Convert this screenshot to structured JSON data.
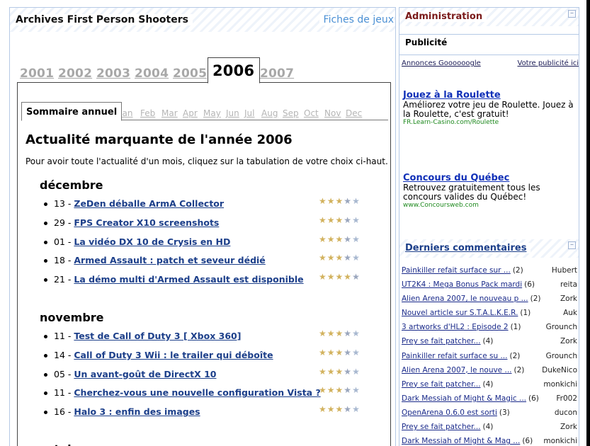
{
  "main": {
    "title": "Archives First Person Shooters",
    "link": "Fiches de jeux",
    "years": [
      {
        "label": "2001",
        "active": false
      },
      {
        "label": "2002",
        "active": false
      },
      {
        "label": "2003",
        "active": false
      },
      {
        "label": "2004",
        "active": false
      },
      {
        "label": "2005",
        "active": false
      },
      {
        "label": "2006",
        "active": true
      },
      {
        "label": "2007",
        "active": false
      }
    ],
    "month_tabs": [
      "Sommaire annuel",
      "Jan",
      "Feb",
      "Mar",
      "Apr",
      "May",
      "Jun",
      "Jul",
      "Aug",
      "Sep",
      "Oct",
      "Nov",
      "Dec"
    ],
    "heading": "Actualité marquante de l'année 2006",
    "intro": "Pour avoir toute l'actualité d'un mois, cliquez sur la tabulation de votre choix ci-haut.",
    "months": [
      {
        "name": "décembre",
        "items": [
          {
            "date": "13",
            "title": "ZeDen déballe ArmA Collector",
            "rating": 3.5
          },
          {
            "date": "29",
            "title": "FPS Creator X10 screenshots",
            "rating": 3.5
          },
          {
            "date": "01",
            "title": "La vidéo DX 10 de Crysis en HD",
            "rating": 3.5
          },
          {
            "date": "18",
            "title": "Armed Assault : patch et seveur dédié",
            "rating": 3.5
          },
          {
            "date": "21",
            "title": "La démo multi d'Armed Assault est disponible",
            "rating": 4.5
          }
        ]
      },
      {
        "name": "novembre",
        "items": [
          {
            "date": "11",
            "title": "Test de Call of Duty 3 [ Xbox 360]",
            "rating": 3.5
          },
          {
            "date": "14",
            "title": "Call of Duty 3 Wii : le trailer qui déboîte",
            "rating": 3.5
          },
          {
            "date": "05",
            "title": "Un avant-goût de DirectX 10",
            "rating": 3.5
          },
          {
            "date": "11",
            "title": "Cherchez-vous une nouvelle configuration Vista ?",
            "rating": 3.5
          },
          {
            "date": "16",
            "title": "Halo 3 : enfin des images",
            "rating": 3.5
          }
        ]
      },
      {
        "name": "octobre",
        "items": []
      }
    ]
  },
  "side": {
    "admin_title": "Administration",
    "collapse_symbol": "–",
    "pub_title": "Publicité",
    "ads_left": "Annonces Goooooogle",
    "ads_right": "Votre publicité ici",
    "ads": [
      {
        "title": "Jouez à la Roulette",
        "text": "Améliorez votre jeu de Roulette. Jouez à la Roulette, c'est gratuit!",
        "url": "FR.Learn-Casino.com/Roulette"
      },
      {
        "title": "Concours du Québec",
        "text": "Retrouvez gratuitement tous les concours valides du Québec!",
        "url": "www.Concoursweb.com"
      }
    ],
    "comments_title": "Derniers commentaires",
    "comments": [
      {
        "title": "Painkiller refait surface sur ...",
        "count": "(2)",
        "author": "Hubert"
      },
      {
        "title": "UT2K4 : Mega Bonus Pack mardi",
        "count": "(6)",
        "author": "reita"
      },
      {
        "title": "Alien Arena 2007, le nouveau p ...",
        "count": "(2)",
        "author": "Zork"
      },
      {
        "title": "Nouvel article sur S.T.A.L.K.E.R.",
        "count": "(1)",
        "author": "Auk"
      },
      {
        "title": "3 artworks d'HL2 : Episode 2",
        "count": "(1)",
        "author": "Grounch"
      },
      {
        "title": "Prey se fait patcher...",
        "count": "(4)",
        "author": "Zork"
      },
      {
        "title": "Painkiller refait surface su ...",
        "count": "(2)",
        "author": "Grounch"
      },
      {
        "title": "Alien Arena 2007, le nouve ...",
        "count": "(2)",
        "author": "DukeNico"
      },
      {
        "title": "Prey se fait patcher...",
        "count": "(4)",
        "author": "monkichi"
      },
      {
        "title": "Dark Messiah of Might & Magic ...",
        "count": "(6)",
        "author": "Fr002"
      },
      {
        "title": "OpenArena 0.6.0 est sorti",
        "count": "(3)",
        "author": "ducon"
      },
      {
        "title": "Prey se fait patcher...",
        "count": "(4)",
        "author": "Zork"
      },
      {
        "title": "Dark Messiah of Might & Mag ...",
        "count": "(6)",
        "author": "monkichi"
      }
    ]
  }
}
